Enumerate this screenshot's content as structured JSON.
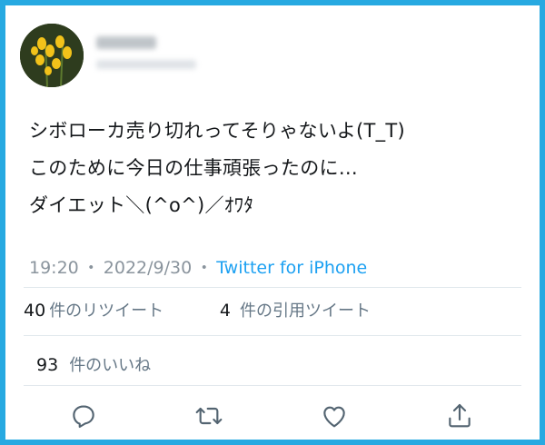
{
  "tweet": {
    "lines": [
      "シボローカ売り切れってそりゃないよ(T_T)",
      "このために今日の仕事頑張ったのに…",
      "ダイエット＼(^o^)／ｵﾜﾀ"
    ],
    "time": "19:20",
    "date": "2022/9/30",
    "source": "Twitter for iPhone",
    "separator": "・"
  },
  "stats": {
    "retweets_count": "40",
    "retweets_label": "件のリツイート",
    "quotes_count": "4",
    "quotes_label": "件の引用ツイート",
    "likes_count": "93",
    "likes_label": "件のいいね"
  },
  "actions": [
    {
      "icon": "reply-icon"
    },
    {
      "icon": "retweet-icon"
    },
    {
      "icon": "like-icon"
    },
    {
      "icon": "share-icon"
    }
  ],
  "colors": {
    "frame": "#27a9e1",
    "text": "#14171a",
    "muted": "#8a949d",
    "link": "#1da1f2",
    "icon": "#536471"
  }
}
